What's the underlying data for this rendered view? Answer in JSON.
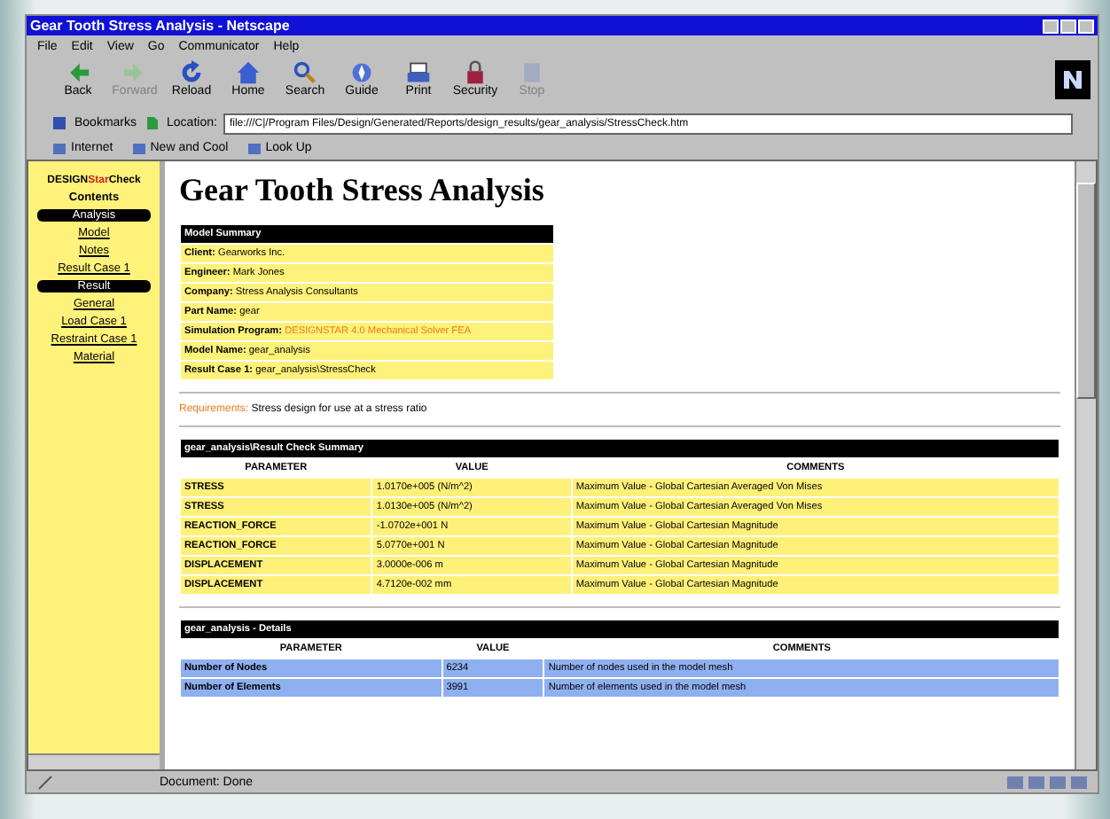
{
  "window": {
    "title": "Gear Tooth Stress Analysis - Netscape"
  },
  "menu": [
    "File",
    "Edit",
    "View",
    "Go",
    "Communicator",
    "Help"
  ],
  "toolbar": [
    {
      "label": "Back",
      "disabled": false
    },
    {
      "label": "Forward",
      "disabled": true
    },
    {
      "label": "Reload",
      "disabled": false
    },
    {
      "label": "Home",
      "disabled": false
    },
    {
      "label": "Search",
      "disabled": false
    },
    {
      "label": "Guide",
      "disabled": false
    },
    {
      "label": "Print",
      "disabled": false
    },
    {
      "label": "Security",
      "disabled": false
    },
    {
      "label": "Stop",
      "disabled": true
    }
  ],
  "location": {
    "bookmarks": "Bookmarks",
    "label": "Location:",
    "value": "file:///C|/Program Files/Design/Generated/Reports/design_results/gear_analysis/StressCheck.htm"
  },
  "personal_toolbar": [
    "Internet",
    "New and Cool",
    "Look Up"
  ],
  "sidebar": {
    "logo_left": "DESIGN",
    "logo_mid": "Star",
    "logo_right": "Check",
    "title": "Contents",
    "items": [
      {
        "kind": "section",
        "label": "Analysis"
      },
      {
        "kind": "link",
        "label": "Model"
      },
      {
        "kind": "link",
        "label": "Notes"
      },
      {
        "kind": "link",
        "label": "Result Case 1"
      },
      {
        "kind": "section",
        "label": "Result"
      },
      {
        "kind": "link",
        "label": "General"
      },
      {
        "kind": "link",
        "label": "Load Case 1"
      },
      {
        "kind": "link",
        "label": "Restraint Case 1"
      },
      {
        "kind": "link",
        "label": "Material"
      }
    ]
  },
  "heading": "Gear Tooth Stress Analysis",
  "model_summary": {
    "title": "Model Summary",
    "rows": [
      {
        "label": "Client:",
        "value": "Gearworks Inc.",
        "highlight": false
      },
      {
        "label": "Engineer:",
        "value": "Mark Jones",
        "highlight": false
      },
      {
        "label": "Company:",
        "value": "Stress Analysis Consultants",
        "highlight": false
      },
      {
        "label": "Part Name:",
        "value": "gear",
        "highlight": false
      },
      {
        "label": "Simulation Program:",
        "value": "DESIGNSTAR 4.0 Mechanical Solver FEA",
        "highlight": true
      },
      {
        "label": "Model Name:",
        "value": "gear_analysis",
        "highlight": false
      },
      {
        "label": "Result Case 1:",
        "value": "gear_analysis\\StressCheck",
        "highlight": false
      }
    ]
  },
  "requirements": {
    "label": "Requirements:",
    "text": "Stress design for use at a stress ratio"
  },
  "result_table": {
    "title": "gear_analysis\\Result Check Summary",
    "color": "#fff07a",
    "columns": [
      "PARAMETER",
      "VALUE",
      "COMMENTS"
    ],
    "rows": [
      [
        "STRESS",
        "1.0170e+005 (N/m^2)",
        "Maximum Value - Global Cartesian Averaged Von Mises"
      ],
      [
        "STRESS",
        "1.0130e+005 (N/m^2)",
        "Maximum Value - Global Cartesian Averaged Von Mises"
      ],
      [
        "REACTION_FORCE",
        "-1.0702e+001 N",
        "Maximum Value - Global Cartesian Magnitude"
      ],
      [
        "REACTION_FORCE",
        "5.0770e+001 N",
        "Maximum Value - Global Cartesian Magnitude"
      ],
      [
        "DISPLACEMENT",
        "3.0000e-006 m",
        "Maximum Value - Global Cartesian Magnitude"
      ],
      [
        "DISPLACEMENT",
        "4.7120e-002 mm",
        "Maximum Value - Global Cartesian Magnitude"
      ]
    ]
  },
  "details_table": {
    "title": "gear_analysis - Details",
    "color": "#8fb0f0",
    "columns": [
      "PARAMETER",
      "VALUE",
      "COMMENTS"
    ],
    "rows": [
      [
        "Number of Nodes",
        "6234",
        "Number of nodes used in the model mesh"
      ],
      [
        "Number of Elements",
        "3991",
        "Number of elements used in the model mesh"
      ]
    ]
  },
  "status_bar": "Document: Done"
}
